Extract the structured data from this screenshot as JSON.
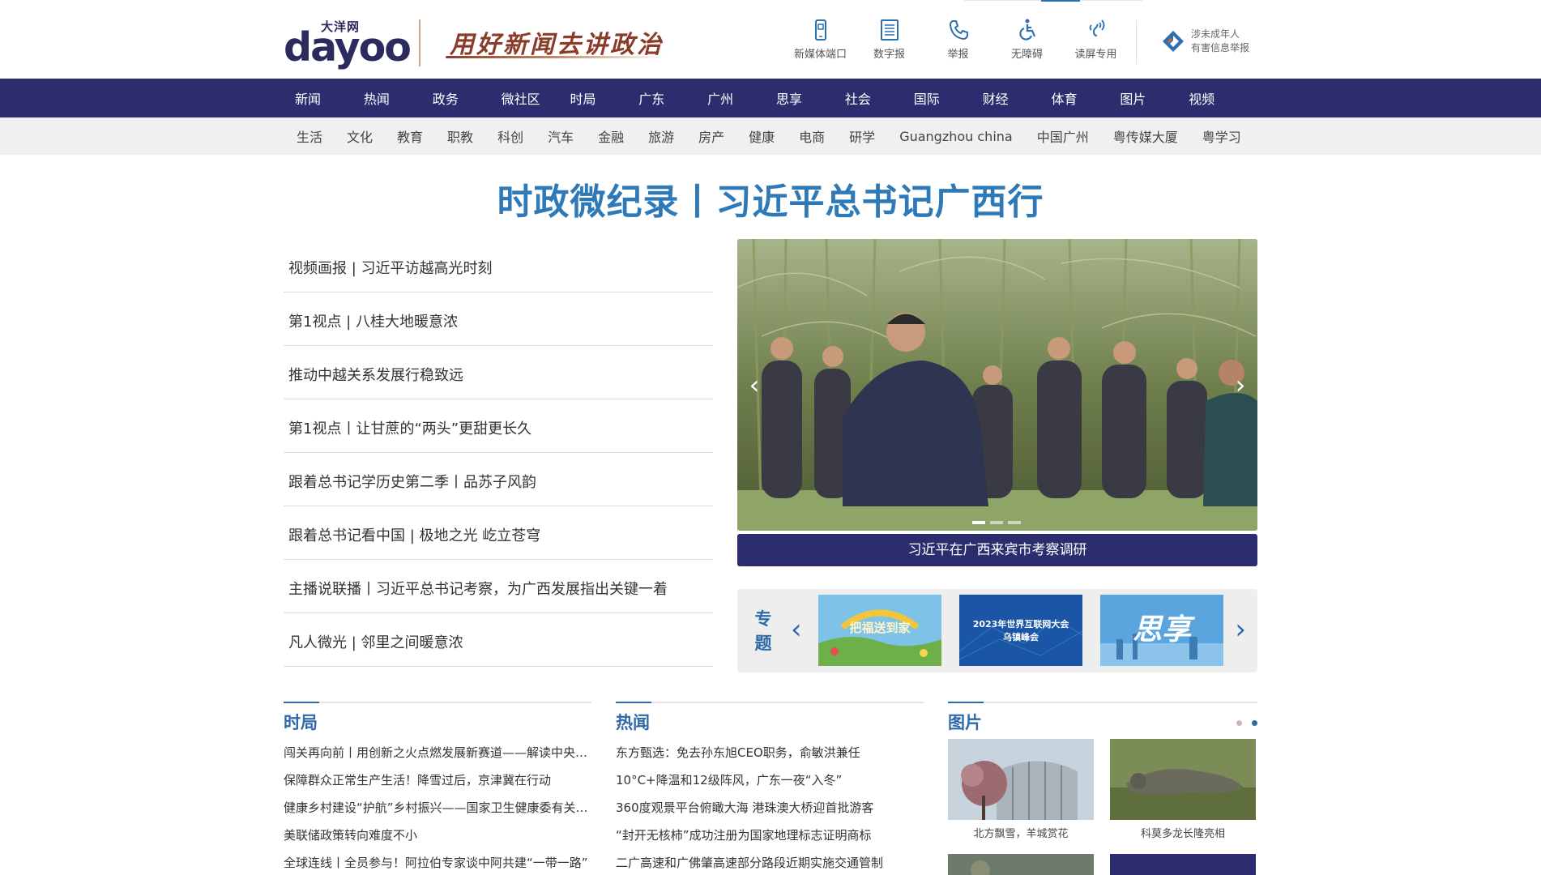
{
  "header": {
    "logo_cn": "大洋网",
    "logo_en": "dayoo",
    "slogan": "用好新闻去讲政治",
    "tools": [
      {
        "icon": "mobile-icon",
        "label": "新媒体端口"
      },
      {
        "icon": "newspaper-icon",
        "label": "数字报"
      },
      {
        "icon": "phone-icon",
        "label": "举报"
      },
      {
        "icon": "wheelchair-icon",
        "label": "无障碍"
      },
      {
        "icon": "screen-reader-icon",
        "label": "读屏专用"
      }
    ],
    "report_line1": "涉未成年人",
    "report_line2": "有害信息举报"
  },
  "nav_main": [
    "新闻",
    "热闻",
    "政务",
    "微社区",
    "时局",
    "广东",
    "广州",
    "思享",
    "社会",
    "国际",
    "财经",
    "体育",
    "图片",
    "视频"
  ],
  "nav_sub": [
    "生活",
    "文化",
    "教育",
    "职教",
    "科创",
    "汽车",
    "金融",
    "旅游",
    "房产",
    "健康",
    "电商",
    "研学",
    "Guangzhou china",
    "中国广州",
    "粤传媒大厦",
    "粤学习"
  ],
  "headline": "时政微纪录丨习近平总书记广西行",
  "news_list": [
    "视频画报 | 习近平访越高光时刻",
    "第1视点 | 八桂大地暖意浓",
    "推动中越关系发展行稳致远",
    "第1视点丨让甘蔗的“两头”更甜更长久",
    "跟着总书记学历史第二季丨品苏子风韵",
    "跟着总书记看中国 | 极地之光 屹立苍穹",
    "主播说联播丨习近平总书记考察，为广西发展指出关键一着",
    "凡人微光 | 邻里之间暖意浓"
  ],
  "slider": {
    "caption": "习近平在广西来宾市考察调研",
    "prev": "‹",
    "next": "›"
  },
  "topics": {
    "label": "专题",
    "prev": "‹",
    "next": "›",
    "items": [
      {
        "text": "把福送到家"
      },
      {
        "text": "2023年世界互联网大会",
        "text2": "乌镇峰会"
      },
      {
        "text": "思享"
      }
    ]
  },
  "columns": {
    "shiju": {
      "title": "时局",
      "items": [
        "闯关再向前丨用创新之火点燃发展新赛道——解读中央经济工作会议",
        "保障群众正常生产生活！降雪过后，京津冀在行动",
        "健康乡村建设“护航”乡村振兴——国家卫生健康委有关负责人解读",
        "美联储政策转向难度不小",
        "全球连线丨全员参与！阿拉伯专家谈中阿共建“一带一路”"
      ]
    },
    "rewen": {
      "title": "热闻",
      "items": [
        "东方甄选：免去孙东旭CEO职务，俞敏洪兼任",
        "10°C+降温和12级阵风，广东一夜“入冬”",
        "360度观景平台俯瞰大海 港珠澳大桥迎首批游客",
        "“封开无核柿”成功注册为国家地理标志证明商标",
        "二广高速和广佛肇高速部分路段近期实施交通管制"
      ]
    },
    "pics": {
      "title": "图片",
      "items": [
        {
          "caption": "北方飘雪，羊城赏花"
        },
        {
          "caption": "科莫多龙长隆亮相"
        }
      ]
    }
  },
  "colors": {
    "nav_bg": "#2c2d6e",
    "accent_blue": "#2e7ab8",
    "sub_nav_bg": "#f0f0f0"
  }
}
